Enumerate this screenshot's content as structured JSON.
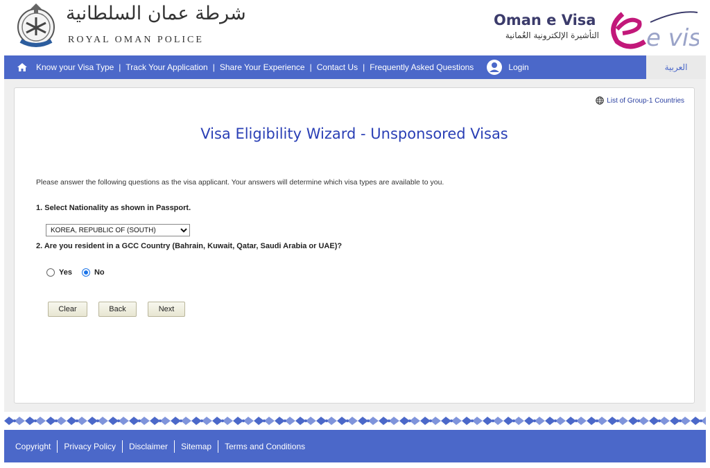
{
  "header": {
    "rop_arabic": "شرطة عمان السلطانية",
    "rop_latin": "ROYAL OMAN POLICE",
    "evisa_title": "Oman e Visa",
    "evisa_subtitle": "التأشيرة الإلكترونية العُمانية",
    "logo_mark": "e visa"
  },
  "nav": {
    "items": [
      {
        "label": "Know your Visa Type"
      },
      {
        "label": "Track Your Application"
      },
      {
        "label": "Share Your Experience"
      },
      {
        "label": "Contact Us"
      },
      {
        "label": "Frequently Asked Questions"
      }
    ],
    "separator": "|",
    "login": "Login",
    "lang": "العربية"
  },
  "main": {
    "group_link": "List of Group-1 Countries",
    "title": "Visa Eligibility Wizard - Unsponsored Visas",
    "intro": "Please answer the following questions as the visa applicant. Your answers will determine which visa types are available to you.",
    "q1": "1. Select Nationality as shown in Passport.",
    "nationality_selected": "KOREA, REPUBLIC OF (SOUTH)",
    "q2": "2. Are you resident in a GCC Country (Bahrain, Kuwait, Qatar, Saudi Arabia or UAE)?",
    "yes_label": "Yes",
    "no_label": "No",
    "selected_answer": "No",
    "buttons": {
      "clear": "Clear",
      "back": "Back",
      "next": "Next"
    }
  },
  "footer": {
    "links": [
      {
        "label": "Copyright"
      },
      {
        "label": "Privacy Policy"
      },
      {
        "label": "Disclaimer"
      },
      {
        "label": "Sitemap"
      },
      {
        "label": "Terms and Conditions"
      }
    ]
  },
  "colors": {
    "nav_bg": "#4b68c9",
    "title": "#2a3fb5",
    "evisa_magenta": "#c2187a"
  }
}
